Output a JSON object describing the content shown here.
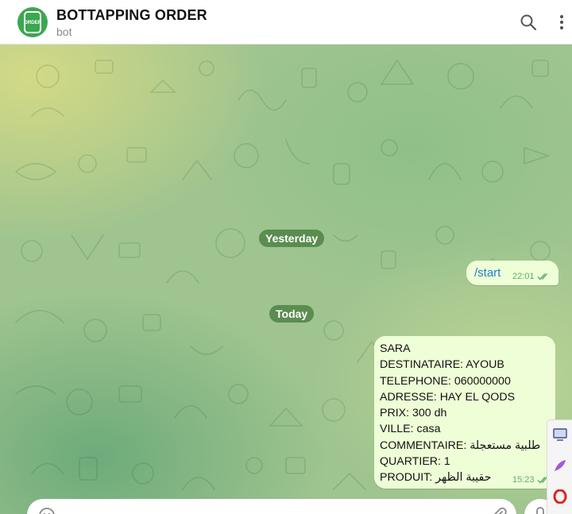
{
  "header": {
    "title": "BOTTAPPING ORDER",
    "subtitle": "bot",
    "avatar_label": "ORDER",
    "icons": [
      "search-icon",
      "more-vertical-icon"
    ]
  },
  "chat": {
    "date_yesterday": "Yesterday",
    "date_today": "Today",
    "messages": [
      {
        "text": "/start",
        "time": "22:01",
        "status": "read"
      },
      {
        "lines": [
          "SARA",
          "DESTINATAIRE: AYOUB",
          "TELEPHONE: 060000000",
          "ADRESSE: HAY EL QODS",
          "PRIX: 300 dh",
          "VILLE: casa",
          "COMMENTAIRE: طلبية مستعجلة",
          "QUARTIER: 1",
          "PRODUIT: حقيبة الظهر"
        ],
        "time": "15:23",
        "status": "read"
      }
    ]
  },
  "composer": {
    "placeholder": "",
    "icons": [
      "emoji-icon",
      "attach-icon",
      "microphone-icon"
    ]
  },
  "dock": {
    "icons": [
      "screen-icon",
      "feather-icon",
      "opera-icon"
    ]
  },
  "colors": {
    "accent": "#3aa850",
    "bubble": "#eefed6",
    "command_link": "#1f7fd4",
    "tick": "#5db064"
  }
}
